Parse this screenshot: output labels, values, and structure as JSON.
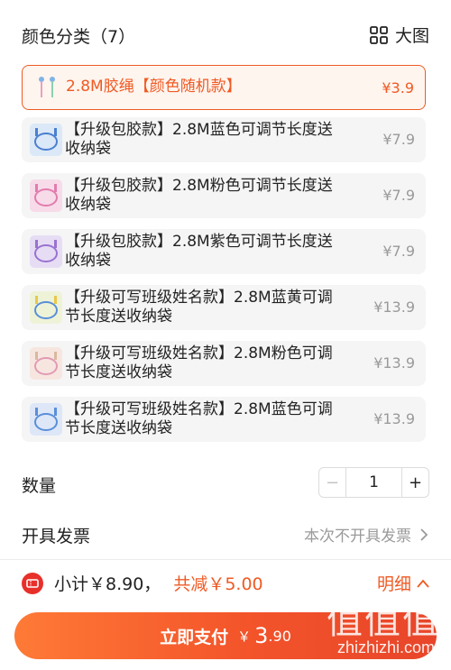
{
  "header": {
    "title": "颜色分类（7）",
    "bigview_label": "大图"
  },
  "options": [
    {
      "label": "2.8M胶绳【颜色随机款】",
      "price": "¥3.9",
      "selected": true,
      "thumb_color": "#7fb3e6"
    },
    {
      "label": "【升级包胶款】2.8M蓝色可调节长度送收纳袋",
      "price": "¥7.9",
      "selected": false,
      "thumb_color": "#4b7fd0"
    },
    {
      "label": "【升级包胶款】2.8M粉色可调节长度送收纳袋",
      "price": "¥7.9",
      "selected": false,
      "thumb_color": "#e27cae"
    },
    {
      "label": "【升级包胶款】2.8M紫色可调节长度送收纳袋",
      "price": "¥7.9",
      "selected": false,
      "thumb_color": "#9a72d0"
    },
    {
      "label": "【升级可写班级姓名款】2.8M蓝黄可调节长度送收纳袋",
      "price": "¥13.9",
      "selected": false,
      "thumb_color": "#e8c84a"
    },
    {
      "label": "【升级可写班级姓名款】2.8M粉色可调节长度送收纳袋",
      "price": "¥13.9",
      "selected": false,
      "thumb_color": "#e29ab4"
    },
    {
      "label": "【升级可写班级姓名款】2.8M蓝色可调节长度送收纳袋",
      "price": "¥13.9",
      "selected": false,
      "thumb_color": "#5a8fd8"
    }
  ],
  "quantity": {
    "label": "数量",
    "minus": "−",
    "value": "1",
    "plus": "+"
  },
  "invoice": {
    "label": "开具发票",
    "value": "本次不开具发票"
  },
  "footer": {
    "subtotal": "小计￥8.90，",
    "discount": "共减￥5.00",
    "detail_label": "明细"
  },
  "pay": {
    "label": "立即支付",
    "currency": "￥",
    "amount_int": "3",
    "amount_dec": ".90"
  },
  "watermark": {
    "logo": "值值值",
    "url": "zhizhizhi.com"
  },
  "colors": {
    "accent": "#ef5a24",
    "muted": "#9a9a9a",
    "option_bg": "#f5f5f5",
    "selected_bg": "#fff5ef"
  }
}
